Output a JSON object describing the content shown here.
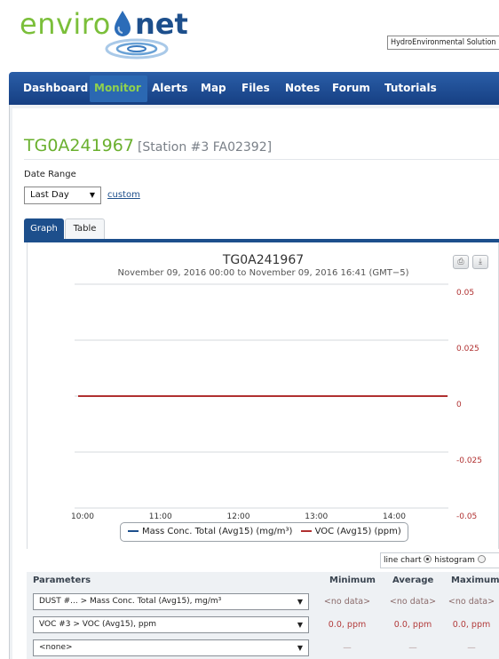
{
  "brand": {
    "logo_left": "enviro",
    "logo_right": "net",
    "company_field": "HydroEnvironmental Solution"
  },
  "nav": {
    "items": [
      "Dashboard",
      "Monitor",
      "Alerts",
      "Map",
      "Files",
      "Notes",
      "Forum",
      "Tutorials"
    ],
    "active": "Monitor"
  },
  "page": {
    "title": "TG0A241967",
    "subtitle": "[Station #3 FA02392]"
  },
  "date_range": {
    "label": "Date Range",
    "selected": "Last Day",
    "custom_link": "custom"
  },
  "tabs": {
    "graph": "Graph",
    "table": "Table",
    "active": "Graph"
  },
  "chart": {
    "title": "TG0A241967",
    "subtitle": "November 09, 2016 00:00 to November 09, 2016 16:41 (GMT−5)",
    "x_ticks": [
      "10:00",
      "11:00",
      "12:00",
      "13:00",
      "14:00"
    ],
    "y_ticks": [
      "0.05",
      "0.025",
      "0",
      "-0.025",
      "-0.05"
    ],
    "legend": [
      "Mass Conc. Total (Avg15) (mg/m³)",
      "VOC (Avg15) (ppm)"
    ],
    "print_icon": "print-icon",
    "download_icon": "download-icon"
  },
  "chart_data": {
    "type": "line",
    "title": "TG0A241967",
    "subtitle": "November 09, 2016 00:00 to November 09, 2016 16:41 (GMT−5)",
    "x": [
      "10:00",
      "11:00",
      "12:00",
      "13:00",
      "14:00"
    ],
    "ylim": [
      -0.05,
      0.05
    ],
    "y_ticks": [
      0.05,
      0.025,
      0,
      -0.025,
      -0.05
    ],
    "grid": true,
    "legend_position": "bottom",
    "series": [
      {
        "name": "Mass Conc. Total (Avg15) (mg/m³)",
        "color": "#1d4f8c",
        "values": []
      },
      {
        "name": "VOC (Avg15) (ppm)",
        "color": "#b03030",
        "values": [
          0,
          0,
          0,
          0,
          0
        ]
      }
    ]
  },
  "chart_type": {
    "line_label": "line chart",
    "histogram_label": "histogram",
    "selected": "line chart"
  },
  "parameters": {
    "header": {
      "name": "Parameters",
      "min": "Minimum",
      "avg": "Average",
      "max": "Maximum"
    },
    "rows": [
      {
        "select": "DUST #... > Mass Conc. Total (Avg15), mg/m³",
        "min": "<no data>",
        "avg": "<no data>",
        "max": "<no data>"
      },
      {
        "select": "VOC #3 > VOC (Avg15), ppm",
        "min": "0.0, ppm",
        "avg": "0.0, ppm",
        "max": "0.0, ppm"
      },
      {
        "select": "<none>",
        "min": "—",
        "avg": "—",
        "max": "—"
      }
    ]
  },
  "colors": {
    "brand_green": "#6ab02e",
    "brand_blue": "#1d4f8c",
    "voc_red": "#b03030"
  }
}
